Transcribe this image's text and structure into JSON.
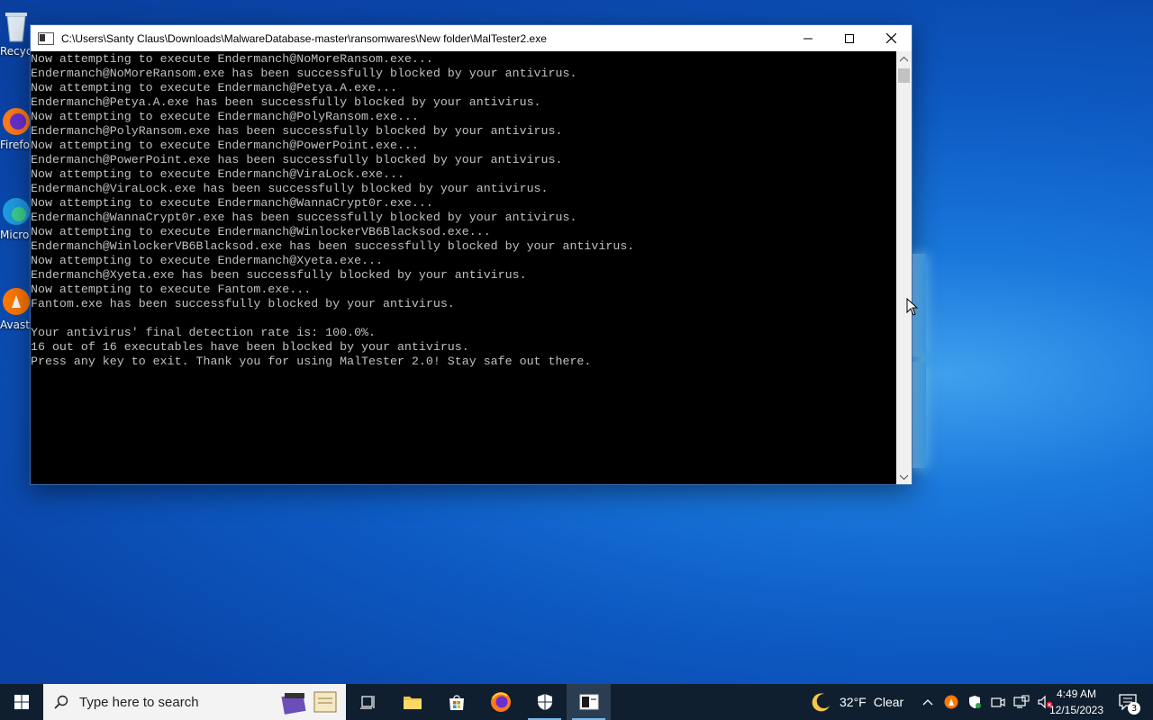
{
  "desktop": {
    "icons": [
      {
        "label": "Recycle Bin",
        "icon": "recycle-bin-icon"
      },
      {
        "label": "Firefox",
        "icon": "firefox-icon"
      },
      {
        "label": "Microsoft Edge",
        "icon": "edge-icon"
      },
      {
        "label": "Avast Antivirus",
        "icon": "avast-icon"
      }
    ]
  },
  "window": {
    "title": "C:\\Users\\Santy Claus\\Downloads\\MalwareDatabase-master\\ransomwares\\New folder\\MalTester2.exe",
    "minimize_label": "minimize",
    "maximize_label": "maximize",
    "close_label": "close"
  },
  "console": {
    "lines": [
      "Now attempting to execute Endermanch@NoMoreRansom.exe...",
      "Endermanch@NoMoreRansom.exe has been successfully blocked by your antivirus.",
      "Now attempting to execute Endermanch@Petya.A.exe...",
      "Endermanch@Petya.A.exe has been successfully blocked by your antivirus.",
      "Now attempting to execute Endermanch@PolyRansom.exe...",
      "Endermanch@PolyRansom.exe has been successfully blocked by your antivirus.",
      "Now attempting to execute Endermanch@PowerPoint.exe...",
      "Endermanch@PowerPoint.exe has been successfully blocked by your antivirus.",
      "Now attempting to execute Endermanch@ViraLock.exe...",
      "Endermanch@ViraLock.exe has been successfully blocked by your antivirus.",
      "Now attempting to execute Endermanch@WannaCrypt0r.exe...",
      "Endermanch@WannaCrypt0r.exe has been successfully blocked by your antivirus.",
      "Now attempting to execute Endermanch@WinlockerVB6Blacksod.exe...",
      "Endermanch@WinlockerVB6Blacksod.exe has been successfully blocked by your antivirus.",
      "Now attempting to execute Endermanch@Xyeta.exe...",
      "Endermanch@Xyeta.exe has been successfully blocked by your antivirus.",
      "Now attempting to execute Fantom.exe...",
      "Fantom.exe has been successfully blocked by your antivirus.",
      "",
      "Your antivirus' final detection rate is: 100.0%.",
      "16 out of 16 executables have been blocked by your antivirus.",
      "Press any key to exit. Thank you for using MalTester 2.0! Stay safe out there."
    ]
  },
  "taskbar": {
    "search_placeholder": "Type here to search",
    "apps": [
      "task-view",
      "file-explorer",
      "microsoft-store",
      "firefox",
      "windows-security",
      "console"
    ],
    "weather_temp": "32°F",
    "weather_desc": "Clear",
    "time": "4:49 AM",
    "date": "12/15/2023",
    "notification_count": "3"
  },
  "colors": {
    "console_bg": "#000000",
    "console_text": "#c0c0c0",
    "taskbar_bg": "#0f1f30"
  }
}
